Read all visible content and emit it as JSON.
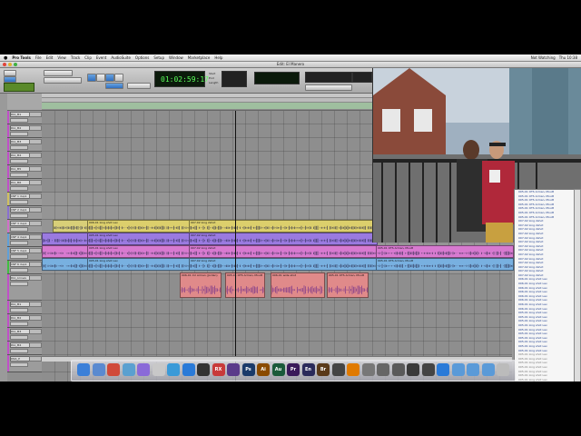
{
  "menubar": {
    "app_name": "Pro Tools",
    "items": [
      "File",
      "Edit",
      "View",
      "Track",
      "Clip",
      "Event",
      "AudioSuite",
      "Options",
      "Setup",
      "Window",
      "Marketplace",
      "Help"
    ],
    "right": [
      "Not Watching",
      "Thu 10:38"
    ]
  },
  "window_title": "Edit: El Manero",
  "counter": {
    "main": "01:02:59:17",
    "start_label": "Start",
    "end_label": "End",
    "length_label": "Length"
  },
  "tracks": [
    {
      "name": "DIA_M1",
      "color": "#c050c8"
    },
    {
      "name": "DIA_M2",
      "color": "#c050c8"
    },
    {
      "name": "DIA_M3",
      "color": "#c050c8"
    },
    {
      "name": "DIA_M4",
      "color": "#c050c8"
    },
    {
      "name": "DIA_M5",
      "color": "#c050c8"
    },
    {
      "name": "DIA_M6",
      "color": "#c050c8"
    },
    {
      "name": "CNF 1 dup1",
      "color": "#d0c060"
    },
    {
      "name": "CNF 2 dup1",
      "color": "#8a70d0"
    },
    {
      "name": "CNF 3 dup1",
      "color": "#d070c8"
    },
    {
      "name": "CNF 4 dup1",
      "color": "#60a0d8"
    },
    {
      "name": "CNF 5 dup1",
      "color": "#60a0d8"
    },
    {
      "name": "CNF 6 dup1",
      "color": "#40c040"
    },
    {
      "name": "DIA_Arrows",
      "color": "#c050c8"
    },
    {
      "name": "DIA_M1",
      "color": "#c050c8"
    },
    {
      "name": "DIA_M2",
      "color": "#c050c8"
    },
    {
      "name": "DIA_M3",
      "color": "#c050c8"
    },
    {
      "name": "DIA_M4",
      "color": "#c050c8"
    },
    {
      "name": "DNA_P",
      "color": "#c050c8"
    }
  ],
  "clips": {
    "yellow_a": "006-01 long shot Lav",
    "yellow_b": "007-02 long 2shot",
    "purple_a": "005-01 long shot Lav",
    "purple_b": "007-02 long 2shot",
    "pink_a": "005-01 long shot Lav",
    "pink_b": "007-02 long 2shot",
    "pink_c": "005-01 OTS Arman, Moutt",
    "blue_a": "005-01 long shot Lav",
    "blue_b": "007-02 long 2shot",
    "blue_c": "005-01 OTS Arman, Moutt",
    "red_a": "006-01 CU Arman (Jordan)",
    "red_b": "005-01 OTS Arman, Moutt",
    "red_c": "006-01 wide shot",
    "red_d": "005-01 OTS Arman, Moutt"
  },
  "region_list": [
    "005-01 OTS Arman, Moutt",
    "005-01 OTS Arman, Moutt",
    "005-01 OTS Arman, Moutt",
    "005-01 OTS Arman, Moutt",
    "005-01 OTS Arman, Moutt",
    "005-01 OTS Arman, Moutt",
    "005-01 OTS Arman, Moutt",
    "007-02 long 2shot",
    "007-02 long 2shot",
    "007-02 long 2shot",
    "007-02 long 2shot",
    "007-02 long 2shot",
    "007-02 long 2shot",
    "007-02 long 2shot",
    "007-02 long 2shot",
    "007-02 long 2shot",
    "007-02 long 2shot",
    "007-02 long 2shot",
    "007-02 long 2shot",
    "007-02 long 2shot",
    "007-02 long 2shot",
    "006-01 long shot Lav",
    "006-01 long shot Lav",
    "006-01 long shot Lav",
    "006-01 long shot Lav",
    "006-01 long shot Lav",
    "006-01 long shot Lav",
    "006-01 long shot Lav",
    "006-01 long shot Lav",
    "005-01 long shot Lav",
    "005-01 long shot Lav",
    "005-01 long shot Lav",
    "005-01 long shot Lav",
    "005-01 long shot Lav",
    "005-01 long shot Lav",
    "005-01 long shot Lav",
    "005-01 long shot Lav",
    "005-01 long shot Lav",
    "005-01 long shot Lav",
    "005-01 long shot Lav",
    "005-01 long shot Lav",
    "005-01 long shot Lav",
    "005-01 long shot Lav",
    "005-01 long shot Lav",
    "005-01 long shot Lav",
    "005-01 long shot Lav",
    "005-01 long shot Lav",
    "005-01 long shot Lav",
    "005-01 long shot Lav",
    "005-01 long shot Lav",
    "005-01 long shot Lav",
    "005-01 long shot Lav"
  ],
  "dock": [
    {
      "name": "finder-icon",
      "label": "",
      "color": "#3b7fd8"
    },
    {
      "name": "mail-icon",
      "label": "",
      "color": "#5a8ad0"
    },
    {
      "name": "chrome-icon",
      "label": "",
      "color": "#d04a3a"
    },
    {
      "name": "preview-icon",
      "label": "",
      "color": "#5aa0d0"
    },
    {
      "name": "itunes-icon",
      "label": "",
      "color": "#8a6ad8"
    },
    {
      "name": "textedit-icon",
      "label": "",
      "color": "#c8c8c8"
    },
    {
      "name": "safari-icon",
      "label": "",
      "color": "#3a9ad8"
    },
    {
      "name": "appstore-icon",
      "label": "",
      "color": "#2a7ad8"
    },
    {
      "name": "protools-icon",
      "label": "",
      "color": "#333"
    },
    {
      "name": "rx-icon",
      "label": "RX",
      "color": "#c83a3a"
    },
    {
      "name": "premiere-icon",
      "label": "",
      "color": "#5a3a8a"
    },
    {
      "name": "photoshop-icon",
      "label": "Ps",
      "color": "#1a3a6a"
    },
    {
      "name": "illustrator-icon",
      "label": "Ai",
      "color": "#8a4a00"
    },
    {
      "name": "audition-icon",
      "label": "Au",
      "color": "#1a5a3a"
    },
    {
      "name": "prelude-icon",
      "label": "Pr",
      "color": "#3a1a5a"
    },
    {
      "name": "encore-icon",
      "label": "En",
      "color": "#2a2a5a"
    },
    {
      "name": "bridge-icon",
      "label": "Br",
      "color": "#5a3a1a"
    },
    {
      "name": "grid-icon",
      "label": "",
      "color": "#444"
    },
    {
      "name": "vlc-icon",
      "label": "",
      "color": "#e07a00"
    },
    {
      "name": "utility-icon",
      "label": "",
      "color": "#777"
    },
    {
      "name": "scanner-icon",
      "label": "",
      "color": "#666"
    },
    {
      "name": "disk-icon",
      "label": "",
      "color": "#5a5a5a"
    },
    {
      "name": "camera-icon",
      "label": "",
      "color": "#3a3a3a"
    },
    {
      "name": "face-icon",
      "label": "",
      "color": "#444"
    },
    {
      "name": "globe-icon",
      "label": "",
      "color": "#2a7ad8"
    },
    {
      "name": "folder-icon-1",
      "label": "",
      "color": "#5a9ad8"
    },
    {
      "name": "folder-icon-2",
      "label": "",
      "color": "#5a9ad8"
    },
    {
      "name": "folder-icon-3",
      "label": "",
      "color": "#5a9ad8"
    },
    {
      "name": "trash-icon",
      "label": "",
      "color": "#bbb"
    }
  ]
}
